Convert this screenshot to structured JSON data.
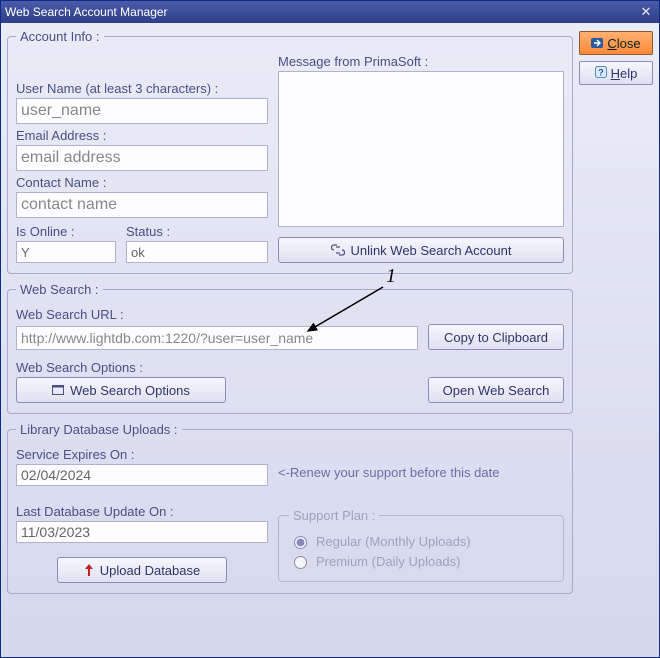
{
  "window": {
    "title": "Web Search Account Manager"
  },
  "side": {
    "close_label": "Close",
    "help_label": "Help"
  },
  "account": {
    "legend": "Account Info :",
    "username_label": "User Name (at least 3 characters) :",
    "username_value": "user_name",
    "email_label": "Email Address :",
    "email_value": "email address",
    "contact_label": "Contact Name :",
    "contact_value": "contact name",
    "isonline_label": "Is Online :",
    "isonline_value": "Y",
    "status_label": "Status :",
    "status_value": "ok",
    "message_label": "Message from PrimaSoft :",
    "message_value": "",
    "unlink_label": "Unlink Web Search Account"
  },
  "websearch": {
    "legend": "Web Search :",
    "url_label": "Web Search URL :",
    "url_value": "http://www.lightdb.com:1220/?user=user_name",
    "copy_label": "Copy to Clipboard",
    "options_label": "Web Search Options :",
    "options_btn": "Web Search Options",
    "open_btn": "Open Web Search"
  },
  "uploads": {
    "legend": "Library Database Uploads :",
    "expires_label": "Service Expires On :",
    "expires_value": "02/04/2024",
    "renew_hint": "<-Renew your support before this date",
    "lastupdate_label": "Last Database Update On :",
    "lastupdate_value": "11/03/2023",
    "upload_btn": "Upload Database",
    "plan_legend": "Support Plan :",
    "plan_regular": "Regular (Monthly Uploads)",
    "plan_premium": "Premium (Daily Uploads)"
  },
  "annotation": {
    "marker": "1"
  }
}
